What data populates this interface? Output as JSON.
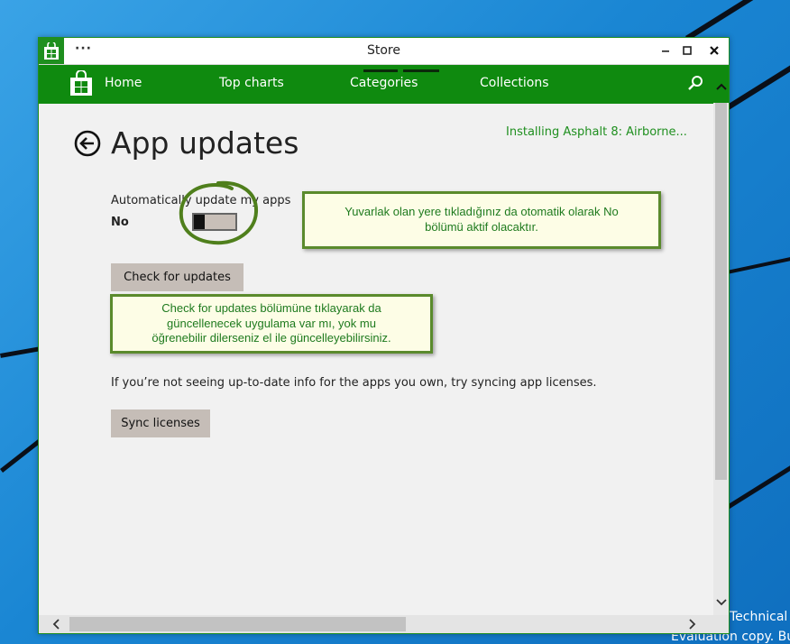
{
  "window": {
    "title": "Store",
    "menu_ellipsis": "···"
  },
  "nav": {
    "items": [
      {
        "label": "Home"
      },
      {
        "label": "Top charts"
      },
      {
        "label": "Categories"
      },
      {
        "label": "Collections"
      }
    ]
  },
  "page": {
    "title": "App updates",
    "installing_status": "Installing Asphalt 8: Airborne...",
    "auto_update_label": "Automatically update my apps",
    "auto_update_value": "No",
    "auto_update_on": false,
    "check_button": "Check for updates",
    "sync_info": "If you’re not seeing up-to-date info for the apps you own, try syncing app licenses.",
    "sync_button": "Sync licenses"
  },
  "callouts": {
    "toggle_note_line1": "Yuvarlak olan yere tıkladığınız da otomatik olarak No",
    "toggle_note_line2": "bölümü aktif olacaktır.",
    "check_note_line1": "Check for updates bölümüne tıklayarak da",
    "check_note_line2": "güncellenecek uygulama var mı, yok mu",
    "check_note_line3": "öğrenebilir dilerseniz el ile güncelleyebilirsiniz."
  },
  "desktop": {
    "watermark_line1": "Technical",
    "watermark_line2": "Evaluation copy. Bui"
  },
  "colors": {
    "store_green": "#0f8a0f",
    "accent_text_green": "#1f8f1f",
    "button_bg": "#c5bdb7",
    "callout_border": "#5a8a2c",
    "callout_bg": "#fdfde6"
  },
  "icons": {
    "store_badge": "store-bag-icon",
    "back": "back-arrow-circle-icon",
    "search": "search-icon",
    "minimize": "minimize-icon",
    "maximize": "maximize-icon",
    "close": "close-icon",
    "scroll_up": "chevron-up-icon",
    "scroll_down": "chevron-down-icon",
    "scroll_left": "chevron-left-icon",
    "scroll_right": "chevron-right-icon"
  }
}
